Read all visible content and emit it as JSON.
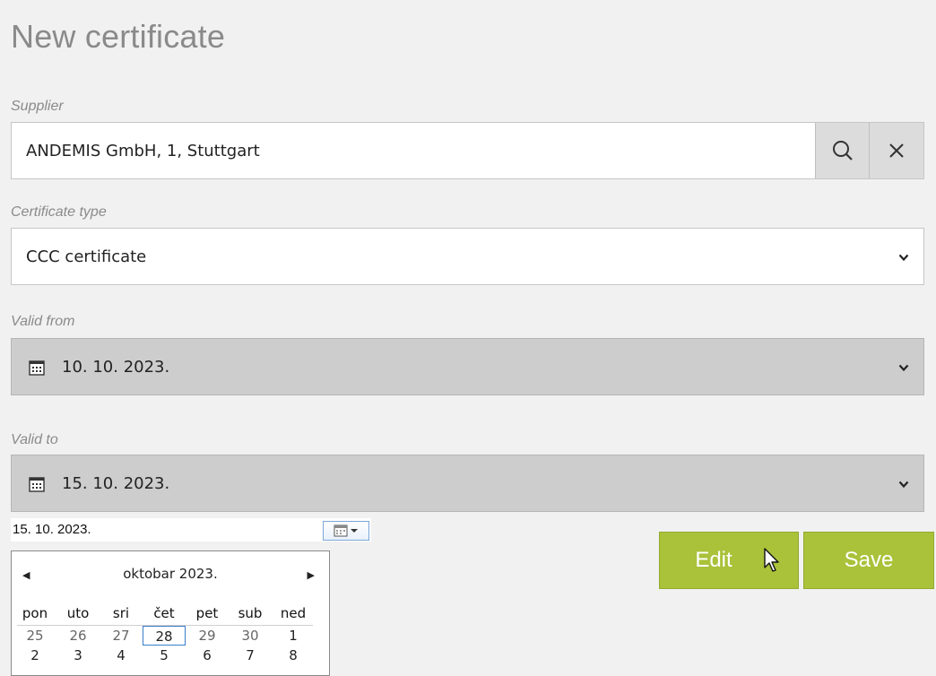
{
  "page_title": "New certificate",
  "supplier": {
    "label": "Supplier",
    "value": "ANDEMIS GmbH, 1, Stuttgart",
    "search_icon": "search-icon",
    "clear_icon": "close-icon"
  },
  "certificate_type": {
    "label": "Certificate type",
    "value": "CCC certificate",
    "icon": "chevron-down-icon"
  },
  "valid_from": {
    "label": "Valid from",
    "value": "10. 10. 2023.",
    "icon": "calendar-icon"
  },
  "valid_to": {
    "label": "Valid to",
    "value": "15. 10. 2023.",
    "icon": "calendar-icon"
  },
  "date_picker": {
    "input_value": "15. 10. 2023.",
    "month_label": "oktobar 2023.",
    "weekdays": [
      "pon",
      "uto",
      "sri",
      "čet",
      "pet",
      "sub",
      "ned"
    ],
    "week1": [
      "25",
      "26",
      "27",
      "28",
      "29",
      "30",
      "1"
    ],
    "week2": [
      "2",
      "3",
      "4",
      "5",
      "6",
      "7",
      "8"
    ],
    "today": "28"
  },
  "actions": {
    "edit_label": "Edit",
    "save_label": "Save",
    "accent": "#a9c23a"
  }
}
